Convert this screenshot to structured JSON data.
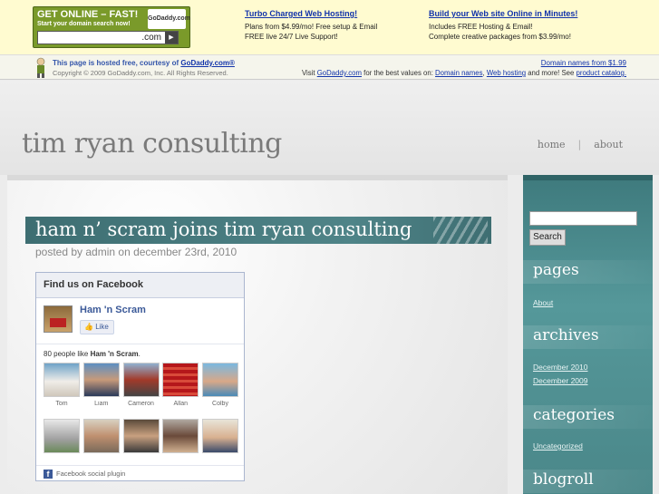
{
  "ad": {
    "godaddy": {
      "headline": "GET ONLINE – FAST!",
      "sub": "Start your domain search now!",
      "logo": "GoDaddy.com",
      "tld": ".com"
    },
    "col1": {
      "title": "Turbo Charged Web Hosting!",
      "line1": "Plans from $4.99/mo! Free setup & Email",
      "line2": "FREE live 24/7 Live Support!"
    },
    "col2": {
      "title": "Build your Web site Online in Minutes!",
      "line1": "Includes FREE Hosting & Email!",
      "line2": "Complete creative packages from $3.99/mo!"
    }
  },
  "host": {
    "line1_prefix": "This page is hosted free, courtesy of ",
    "line1_link": "GoDaddy.com®",
    "line2": "Copyright © 2009 GoDaddy.com, Inc. All Rights Reserved.",
    "right1": "Domain names from $1.99",
    "right2_a": "Visit ",
    "right2_link1": "GoDaddy.com",
    "right2_b": " for the best values on: ",
    "right2_link2": "Domain names",
    "right2_c": ", ",
    "right2_link3": "Web hosting",
    "right2_d": " and more! See ",
    "right2_link4": "product catalog."
  },
  "header": {
    "title": "tim ryan consulting",
    "nav": [
      "home",
      "about"
    ]
  },
  "post": {
    "title": "ham n’ scram joins tim ryan consulting",
    "meta": "posted by admin on december 23rd, 2010"
  },
  "facebook": {
    "header": "Find us on Facebook",
    "page_name": "Ham 'n Scram",
    "like_label": "Like",
    "count_prefix": "80 people like ",
    "count_page": "Ham 'n Scram",
    "count_suffix": ".",
    "faces_row1": [
      "Tom",
      "Liam",
      "Cameron",
      "Allan",
      "Colby"
    ],
    "faces_row2": [
      "",
      "",
      "",
      "",
      ""
    ],
    "footer": "Facebook social plugin"
  },
  "sidebar": {
    "search_button": "Search",
    "sections": [
      {
        "title": "pages",
        "links": [
          "About"
        ]
      },
      {
        "title": "archives",
        "links": [
          "December 2010",
          "December 2009"
        ]
      },
      {
        "title": "categories",
        "links": [
          "Uncategorized"
        ]
      },
      {
        "title": "blogroll",
        "links": []
      }
    ]
  },
  "colors": {
    "teal": "#4c8a8c",
    "godaddy_green": "#7a9a2a",
    "facebook_blue": "#3b5998"
  }
}
